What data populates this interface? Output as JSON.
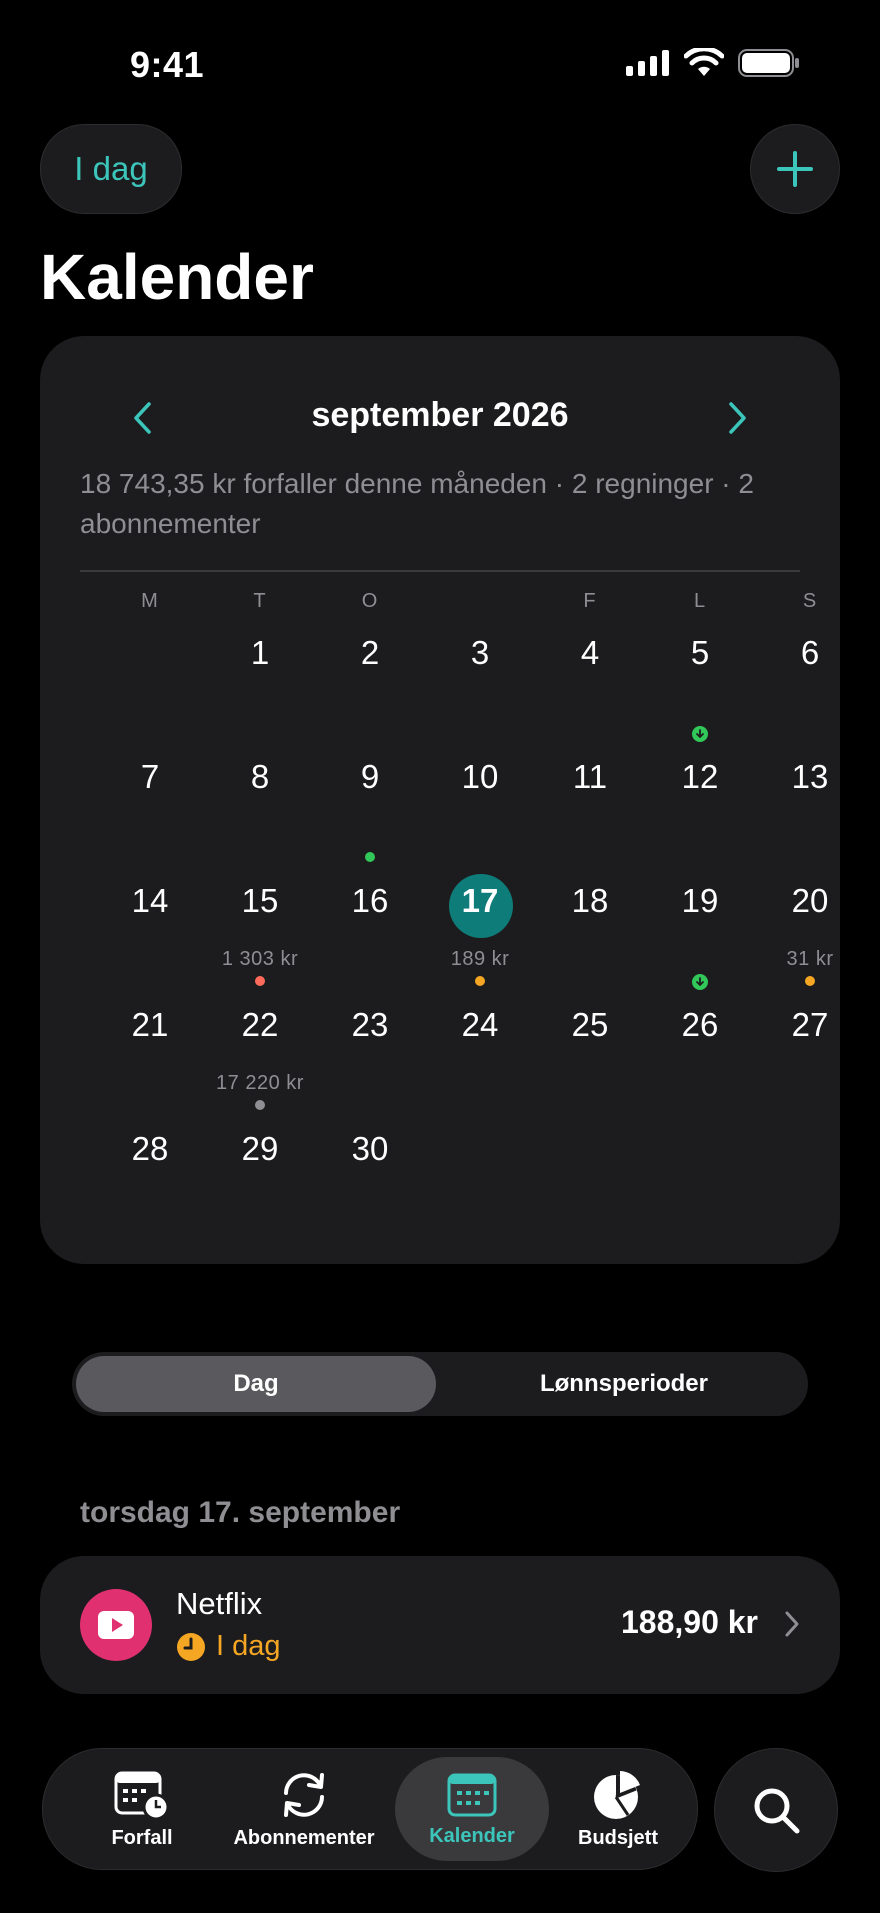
{
  "status_bar": {
    "time": "9:41"
  },
  "header": {
    "today_button": "I dag",
    "title": "Kalender"
  },
  "calendar": {
    "month": "september 2026",
    "summary": "18 743,35 kr forfaller denne måneden · 2 regninger · 2 abonnementer",
    "weekdays": [
      "M",
      "T",
      "O",
      "",
      "F",
      "L",
      "S"
    ],
    "days": [
      {
        "day": "1",
        "col": 1,
        "row": 0
      },
      {
        "day": "2",
        "col": 2,
        "row": 0
      },
      {
        "day": "3",
        "col": 3,
        "row": 0
      },
      {
        "day": "4",
        "col": 4,
        "row": 0
      },
      {
        "day": "5",
        "col": 5,
        "row": 0,
        "marker": "income"
      },
      {
        "day": "6",
        "col": 6,
        "row": 0
      },
      {
        "day": "7",
        "col": 0,
        "row": 1
      },
      {
        "day": "8",
        "col": 1,
        "row": 1
      },
      {
        "day": "9",
        "col": 2,
        "row": 1,
        "marker": "green"
      },
      {
        "day": "10",
        "col": 3,
        "row": 1
      },
      {
        "day": "11",
        "col": 4,
        "row": 1
      },
      {
        "day": "12",
        "col": 5,
        "row": 1
      },
      {
        "day": "13",
        "col": 6,
        "row": 1
      },
      {
        "day": "14",
        "col": 0,
        "row": 2
      },
      {
        "day": "15",
        "col": 1,
        "row": 2,
        "amount": "1 303 kr",
        "marker": "red"
      },
      {
        "day": "16",
        "col": 2,
        "row": 2
      },
      {
        "day": "17",
        "col": 3,
        "row": 2,
        "amount": "189 kr",
        "marker": "orange",
        "today": true
      },
      {
        "day": "18",
        "col": 4,
        "row": 2
      },
      {
        "day": "19",
        "col": 5,
        "row": 2,
        "marker": "income"
      },
      {
        "day": "20",
        "col": 6,
        "row": 2,
        "amount": "31 kr",
        "marker": "orange"
      },
      {
        "day": "21",
        "col": 0,
        "row": 3
      },
      {
        "day": "22",
        "col": 1,
        "row": 3,
        "amount": "17 220 kr",
        "marker": "gray"
      },
      {
        "day": "23",
        "col": 2,
        "row": 3
      },
      {
        "day": "24",
        "col": 3,
        "row": 3
      },
      {
        "day": "25",
        "col": 4,
        "row": 3
      },
      {
        "day": "26",
        "col": 5,
        "row": 3
      },
      {
        "day": "27",
        "col": 6,
        "row": 3
      },
      {
        "day": "28",
        "col": 0,
        "row": 4
      },
      {
        "day": "29",
        "col": 1,
        "row": 4
      },
      {
        "day": "30",
        "col": 2,
        "row": 4
      }
    ]
  },
  "segmented": {
    "day": "Dag",
    "pay_periods": "Lønnsperioder"
  },
  "selected_day": {
    "heading": "torsdag 17. september",
    "bill": {
      "name": "Netflix",
      "status": "I dag",
      "amount": "188,90 kr",
      "icon": "play-icon"
    }
  },
  "tab_bar": {
    "tabs": [
      {
        "label": "Forfall",
        "icon": "calendar-clock-icon"
      },
      {
        "label": "Abonnementer",
        "icon": "refresh-icon"
      },
      {
        "label": "Kalender",
        "icon": "calendar-icon",
        "active": true
      },
      {
        "label": "Budsjett",
        "icon": "pie-chart-icon"
      }
    ]
  },
  "colors": {
    "accent": "#3cc6bb",
    "today_circle": "#0e7c78",
    "marker_green": "#32c759",
    "marker_red": "#ff6b5b",
    "marker_orange": "#f5a623",
    "marker_gray": "#8e8e93",
    "netflix": "#e0306f"
  }
}
